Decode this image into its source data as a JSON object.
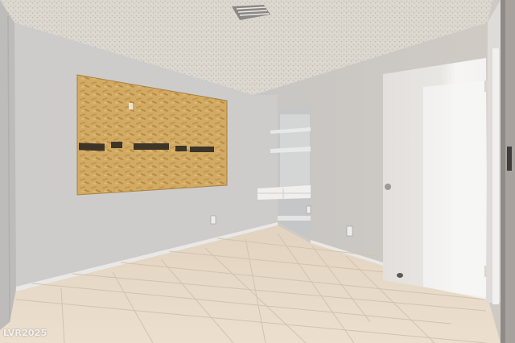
{
  "watermark": {
    "text": "LVR2025"
  },
  "colors": {
    "ceiling": "#dcd7cf",
    "wall_left": "#cdcccb",
    "wall_back": "#c7c4c1",
    "floor": "#e7d8c6",
    "osb_board": "#d2aa62",
    "door": "#eceae8"
  }
}
